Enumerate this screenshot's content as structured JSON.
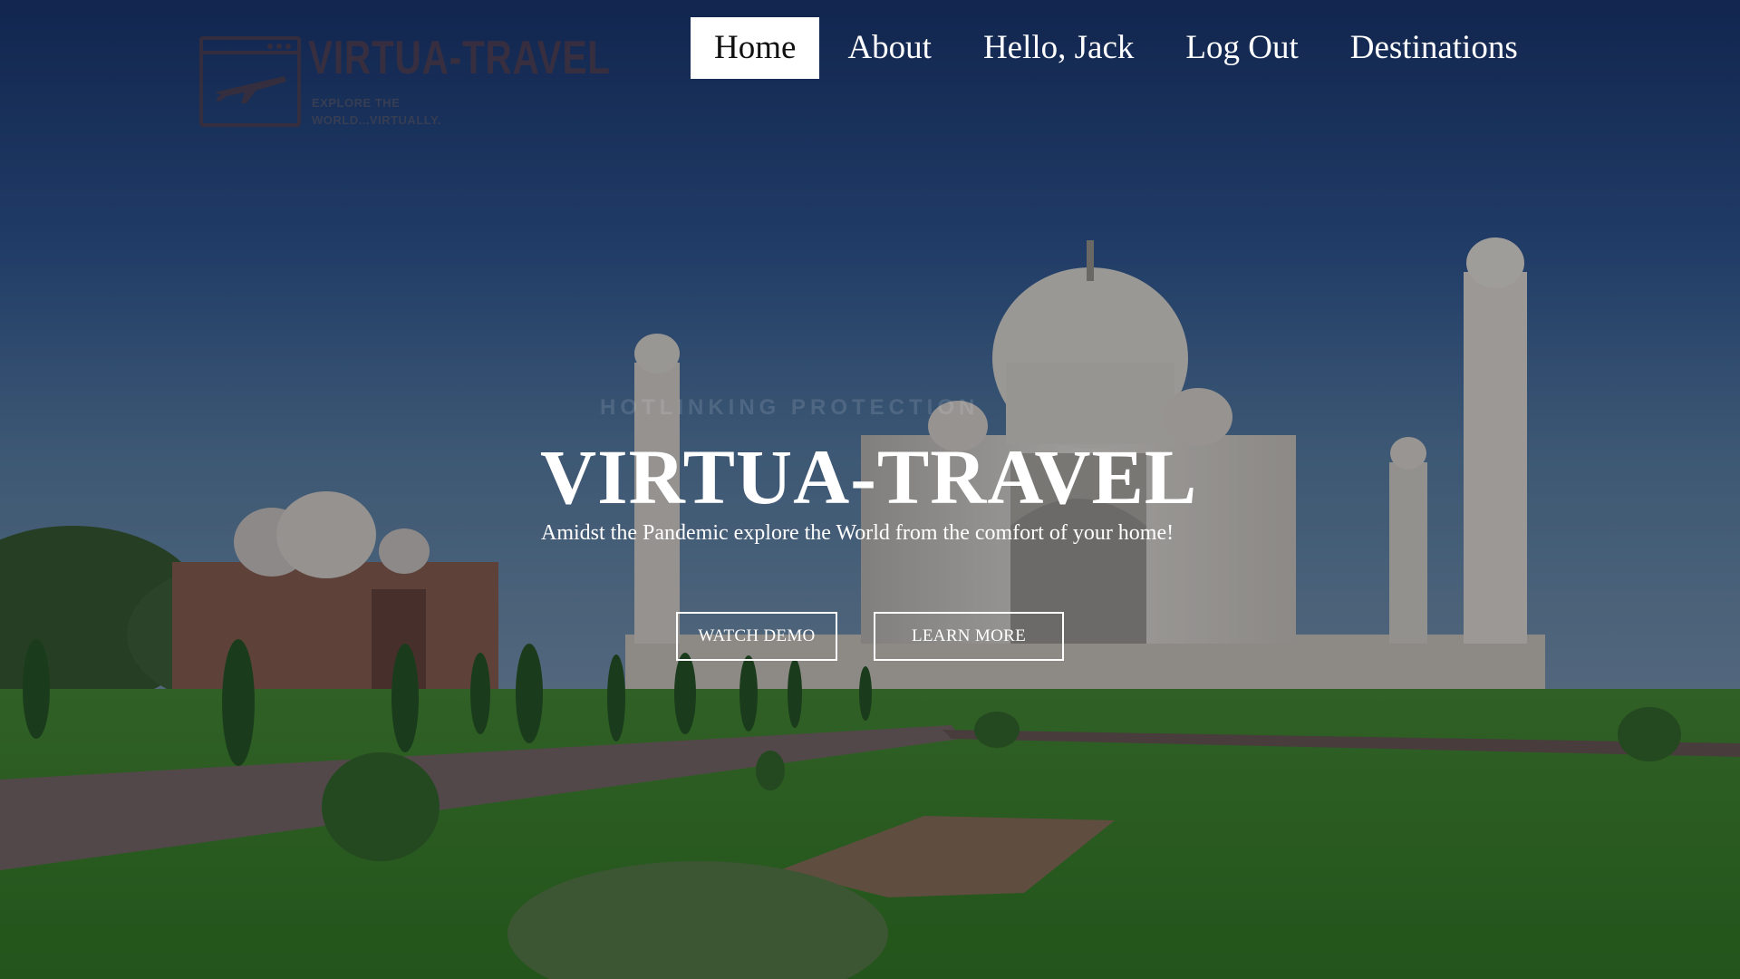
{
  "logo": {
    "title": "VIRTUA-TRAVEL",
    "tagline": "EXPLORE THE WORLD...VIRTUALLY."
  },
  "nav": {
    "items": [
      {
        "label": "Home",
        "active": true
      },
      {
        "label": "About",
        "active": false
      },
      {
        "label": "Hello, Jack",
        "active": false
      },
      {
        "label": "Log Out",
        "active": false
      },
      {
        "label": "Destinations",
        "active": false
      }
    ]
  },
  "hero": {
    "watermark": "HOTLINKING PROTECTION",
    "title": "VIRTUA-TRAVEL",
    "subtitle": "Amidst the Pandemic explore the World from the comfort of your home!",
    "buttons": {
      "watch_demo": "WATCH DEMO",
      "learn_more": "LEARN MORE"
    }
  },
  "colors": {
    "sky_top": "#1a3566",
    "lawn": "#2f6a1f",
    "marble": "#cfcac0",
    "nav_active_bg": "#ffffff",
    "logo": "#3d2f3d"
  }
}
